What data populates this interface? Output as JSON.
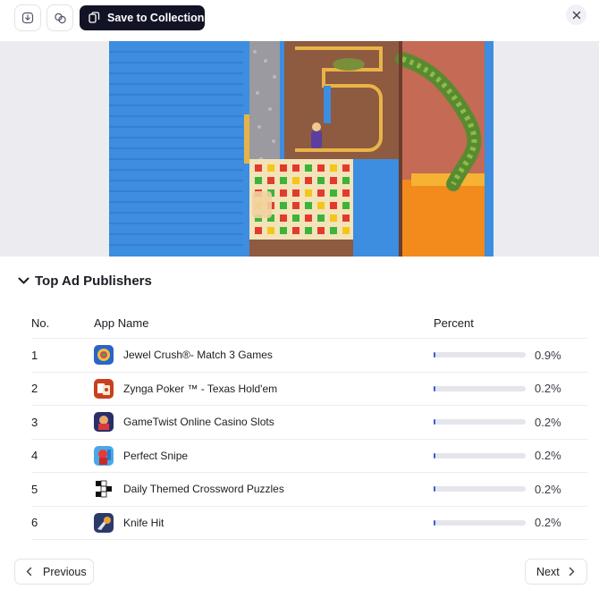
{
  "toolbar": {
    "download_icon": "download-icon",
    "link_icon": "link-icon",
    "save_label": "Save to Collection",
    "close_icon": "close-icon"
  },
  "section": {
    "title": "Top Ad Publishers"
  },
  "table": {
    "headers": {
      "no": "No.",
      "app_name": "App Name",
      "percent": "Percent"
    },
    "rows": [
      {
        "no": "1",
        "name": "Jewel Crush®- Match 3 Games",
        "percent": "0.9%",
        "value": 0.9
      },
      {
        "no": "2",
        "name": "Zynga Poker ™ - Texas Hold'em",
        "percent": "0.2%",
        "value": 0.2
      },
      {
        "no": "3",
        "name": "GameTwist Online Casino Slots",
        "percent": "0.2%",
        "value": 0.2
      },
      {
        "no": "4",
        "name": "Perfect Snipe",
        "percent": "0.2%",
        "value": 0.2
      },
      {
        "no": "5",
        "name": "Daily Themed Crossword Puzzles",
        "percent": "0.2%",
        "value": 0.2
      },
      {
        "no": "6",
        "name": "Knife Hit",
        "percent": "0.2%",
        "value": 0.2
      }
    ]
  },
  "footer": {
    "previous_label": "Previous",
    "next_label": "Next"
  },
  "colors": {
    "save_button_bg": "#121425",
    "bar_fill": "#3a5bd9",
    "bar_track": "#e4e6eb"
  }
}
